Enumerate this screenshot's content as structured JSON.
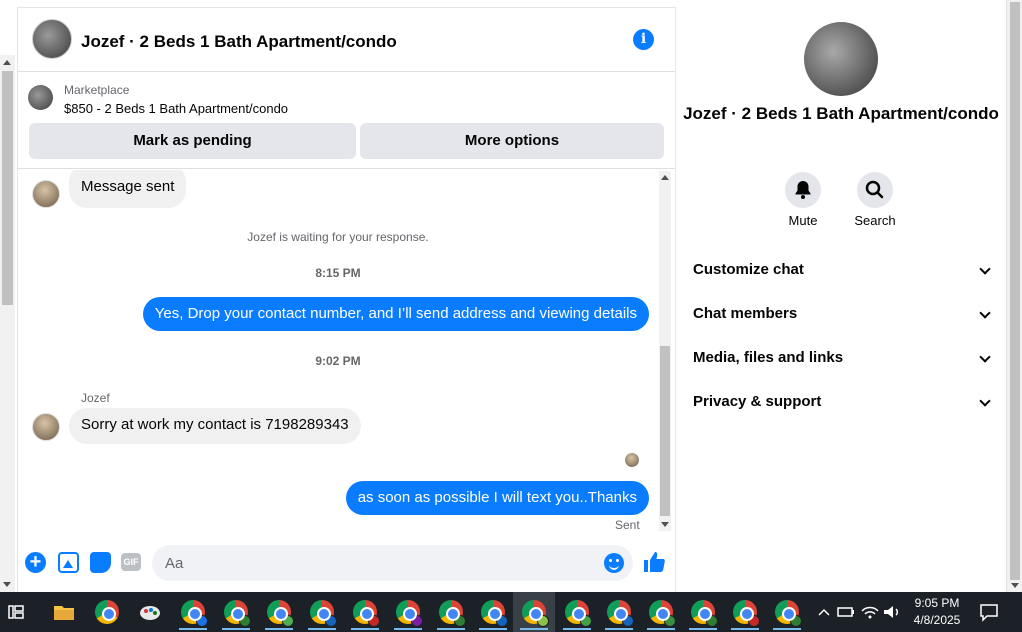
{
  "chat": {
    "title": "Jozef · 2 Beds 1 Bath Apartment/condo",
    "marketplace_label": "Marketplace",
    "listing": "$850 - 2 Beds 1 Bath Apartment/condo",
    "mark_pending": "Mark as pending",
    "more_options": "More options"
  },
  "messages": {
    "first_in": "Message sent",
    "waiting": "Jozef is waiting for your response.",
    "time1": "8:15 PM",
    "out1": "Yes,  Drop your contact number, and I’ll send address and viewing details",
    "time2": "9:02 PM",
    "sender": "Jozef",
    "in2": "Sorry at work my contact is 7198289343",
    "out2": "as soon as possible I will text you..Thanks",
    "status": "Sent"
  },
  "composer": {
    "placeholder": "Aa",
    "gif_label": "GIF",
    "plus_symbol": "+"
  },
  "info": {
    "name": "Jozef · 2 Beds 1 Bath Apartment/condo",
    "mute": "Mute",
    "search": "Search",
    "sections": [
      "Customize chat",
      "Chat members",
      "Media, files and links",
      "Privacy & support"
    ]
  },
  "taskbar": {
    "time": "9:05 PM",
    "date": "4/8/2025"
  },
  "colors": {
    "accent": "#0a7cff",
    "taskbar": "#1c2128"
  }
}
